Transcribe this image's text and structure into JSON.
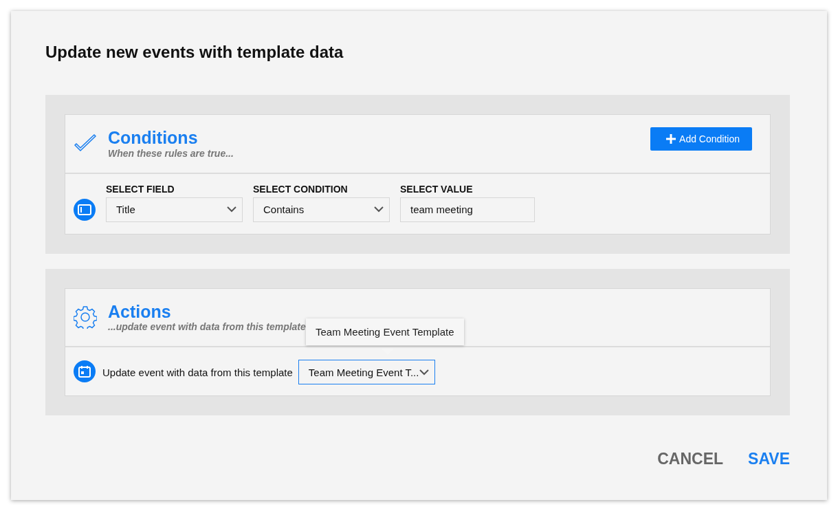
{
  "dialog": {
    "title": "Update new events with template data"
  },
  "conditions": {
    "title": "Conditions",
    "subtitle": "When these rules are true...",
    "add_button": "Add Condition",
    "fields": [
      {
        "label": "SELECT FIELD",
        "kind": "dropdown",
        "value": "Title"
      },
      {
        "label": "SELECT CONDITION",
        "kind": "dropdown",
        "value": "Contains"
      },
      {
        "label": "SELECT VALUE",
        "kind": "text",
        "value": "team meeting"
      }
    ]
  },
  "actions": {
    "title": "Actions",
    "subtitle": "...update event with data from this template",
    "row_label": "Update event with data from this template",
    "template_select": {
      "value": "Team Meeting Event T...",
      "focused": true
    },
    "tooltip": "Team Meeting Event Template"
  },
  "buttons": [
    {
      "label": "CANCEL",
      "kind": "secondary"
    },
    {
      "label": "SAVE",
      "kind": "primary"
    }
  ]
}
